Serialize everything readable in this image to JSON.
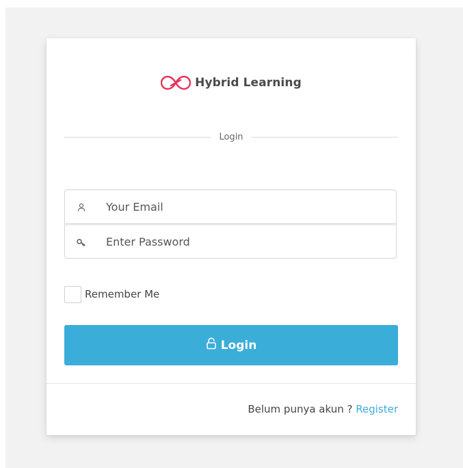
{
  "brand": {
    "name": "Hybrid Learning",
    "logo_icon": "infinity-loop-icon",
    "logo_color": "#e8305a"
  },
  "section_divider": {
    "label": "Login"
  },
  "form": {
    "email": {
      "placeholder": "Your Email",
      "value": "",
      "icon": "user-icon"
    },
    "password": {
      "placeholder": "Enter Password",
      "value": "",
      "icon": "key-icon"
    },
    "remember_me": {
      "label": "Remember Me",
      "checked": false
    },
    "submit": {
      "label": "Login",
      "icon": "unlock-icon",
      "color": "#3badd9"
    }
  },
  "footer": {
    "prompt": "Belum punya akun ?",
    "register_link": "Register",
    "link_color": "#3badd9"
  }
}
